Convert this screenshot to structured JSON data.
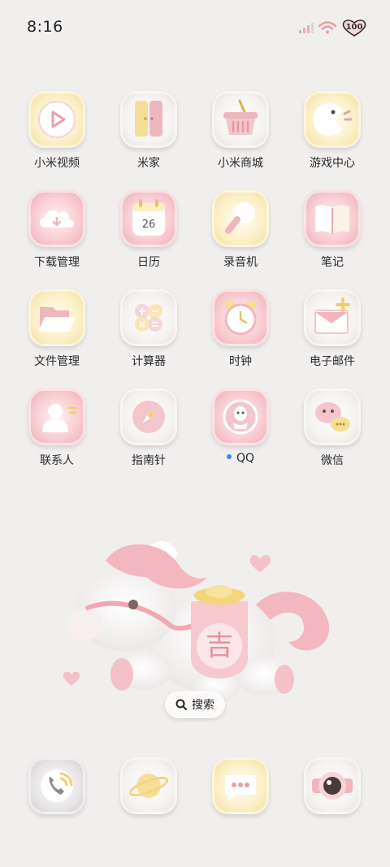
{
  "status_bar": {
    "time": "8:16",
    "battery": "100"
  },
  "apps": [
    [
      {
        "label": "小米视频",
        "name": "app-mi-video",
        "icon": "play-icon"
      },
      {
        "label": "米家",
        "name": "app-mijia",
        "icon": "door-icon"
      },
      {
        "label": "小米商城",
        "name": "app-mi-store",
        "icon": "basket-icon"
      },
      {
        "label": "游戏中心",
        "name": "app-game-center",
        "icon": "pacman-icon"
      }
    ],
    [
      {
        "label": "下载管理",
        "name": "app-downloads",
        "icon": "cloud-icon"
      },
      {
        "label": "日历",
        "name": "app-calendar",
        "icon": "calendar-icon",
        "badge": "26"
      },
      {
        "label": "录音机",
        "name": "app-recorder",
        "icon": "microphone-icon"
      },
      {
        "label": "笔记",
        "name": "app-notes",
        "icon": "book-icon"
      }
    ],
    [
      {
        "label": "文件管理",
        "name": "app-files",
        "icon": "folder-icon"
      },
      {
        "label": "计算器",
        "name": "app-calculator",
        "icon": "calculator-icon"
      },
      {
        "label": "时钟",
        "name": "app-clock",
        "icon": "alarm-clock-icon"
      },
      {
        "label": "电子邮件",
        "name": "app-email",
        "icon": "envelope-icon"
      }
    ],
    [
      {
        "label": "联系人",
        "name": "app-contacts",
        "icon": "person-icon"
      },
      {
        "label": "指南针",
        "name": "app-compass",
        "icon": "compass-icon"
      },
      {
        "label": "QQ",
        "name": "app-qq",
        "icon": "penguin-icon",
        "new_dot": true
      },
      {
        "label": "微信",
        "name": "app-wechat",
        "icon": "chat-bubbles-icon"
      }
    ]
  ],
  "widget": {
    "emblem_char": "吉",
    "search_label": "搜索"
  },
  "dock": [
    {
      "name": "dock-phone",
      "icon": "phone-icon"
    },
    {
      "name": "dock-browser",
      "icon": "planet-icon"
    },
    {
      "name": "dock-messages",
      "icon": "message-icon"
    },
    {
      "name": "dock-camera",
      "icon": "camera-icon"
    }
  ],
  "colors": {
    "pink": "#f0b6bd",
    "yellow": "#f6df95",
    "background": "#f1efee"
  }
}
